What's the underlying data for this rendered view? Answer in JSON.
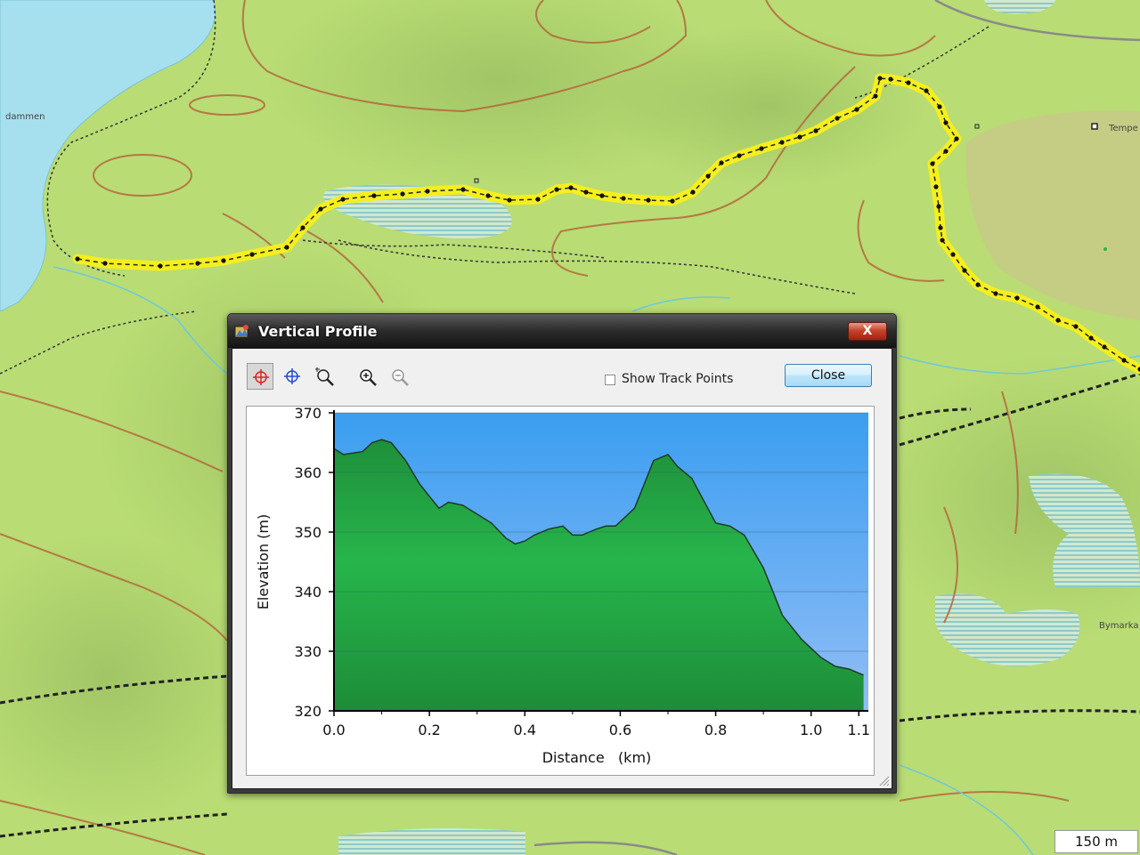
{
  "map": {
    "labels": {
      "lake": "dammen",
      "poi_right": "Tempe",
      "area_right": "Bymarka"
    },
    "scale_label": "150 m",
    "colors": {
      "land": "#b9dc74",
      "water": "#a6e0ef",
      "track_halo": "#f5ef1e",
      "contour": "#b5673b"
    }
  },
  "dialog": {
    "title": "Vertical Profile",
    "close_x": "X",
    "toolbar": {
      "tools": [
        {
          "name": "select-crosshair-red",
          "icon": "crosshair-icon"
        },
        {
          "name": "select-crosshair-blue",
          "icon": "crosshair-icon"
        },
        {
          "name": "zoom-area",
          "icon": "zoom-area-icon"
        },
        {
          "name": "zoom-in",
          "icon": "zoom-in-icon"
        },
        {
          "name": "zoom-out",
          "icon": "zoom-out-icon"
        }
      ],
      "show_track_points_label": "Show Track Points",
      "show_track_points_checked": false,
      "close_label": "Close"
    }
  },
  "chart_data": {
    "type": "area",
    "title": "",
    "xlabel": "Distance   (km)",
    "ylabel": "Elevation (m)",
    "xlim": [
      0.0,
      1.12
    ],
    "ylim": [
      320,
      370
    ],
    "x_ticks": [
      "0.0",
      "0.2",
      "0.4",
      "0.6",
      "0.8",
      "1.0",
      "1.1"
    ],
    "x_tick_values": [
      0.0,
      0.2,
      0.4,
      0.6,
      0.8,
      1.0,
      1.1
    ],
    "y_ticks": [
      "320",
      "330",
      "340",
      "350",
      "360",
      "370"
    ],
    "y_tick_values": [
      320,
      330,
      340,
      350,
      360,
      370
    ],
    "grid": "horizontal",
    "colors": {
      "sky_top": "#3a9ef0",
      "sky_bottom": "#92bdf6",
      "fill": "#26b24a",
      "line": "#1b3a26"
    },
    "x": [
      0.0,
      0.02,
      0.06,
      0.08,
      0.1,
      0.12,
      0.15,
      0.18,
      0.2,
      0.22,
      0.24,
      0.27,
      0.3,
      0.33,
      0.36,
      0.38,
      0.4,
      0.42,
      0.45,
      0.48,
      0.5,
      0.52,
      0.55,
      0.57,
      0.59,
      0.61,
      0.63,
      0.65,
      0.67,
      0.7,
      0.72,
      0.75,
      0.77,
      0.8,
      0.83,
      0.86,
      0.9,
      0.94,
      0.98,
      1.02,
      1.05,
      1.08,
      1.11
    ],
    "y": [
      364,
      363,
      363.5,
      365,
      365.5,
      365,
      362,
      358,
      356,
      354,
      355,
      354.5,
      353,
      351.5,
      349,
      348,
      348.5,
      349.5,
      350.5,
      351,
      349.5,
      349.5,
      350.5,
      351,
      351,
      352.5,
      354,
      358,
      362,
      363,
      361,
      359,
      356,
      351.5,
      351,
      349.5,
      344,
      336,
      332,
      329,
      327.5,
      327,
      326
    ]
  }
}
